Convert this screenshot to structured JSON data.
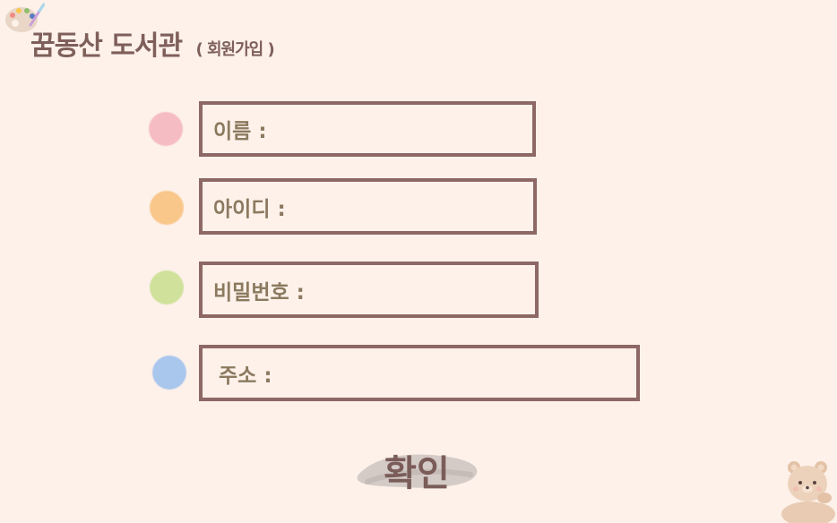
{
  "header": {
    "title": "꿈동산 도서관",
    "subtitle": "( 회원가입 )"
  },
  "form": {
    "name_label": "이름 :",
    "id_label": "아이디 :",
    "password_label": "비밀번호 :",
    "address_label": "주소 :",
    "name_value": "",
    "id_value": "",
    "password_value": "",
    "address_value": ""
  },
  "confirm_label": "확인",
  "colors": {
    "background": "#fdf1ea",
    "border": "#8d6865",
    "dot_pink": "#f6bcc4",
    "dot_orange": "#f9c78a",
    "dot_green": "#cfe19a",
    "dot_blue": "#a9c6ec"
  },
  "icons": [
    "palette-icon",
    "bear-icon"
  ]
}
